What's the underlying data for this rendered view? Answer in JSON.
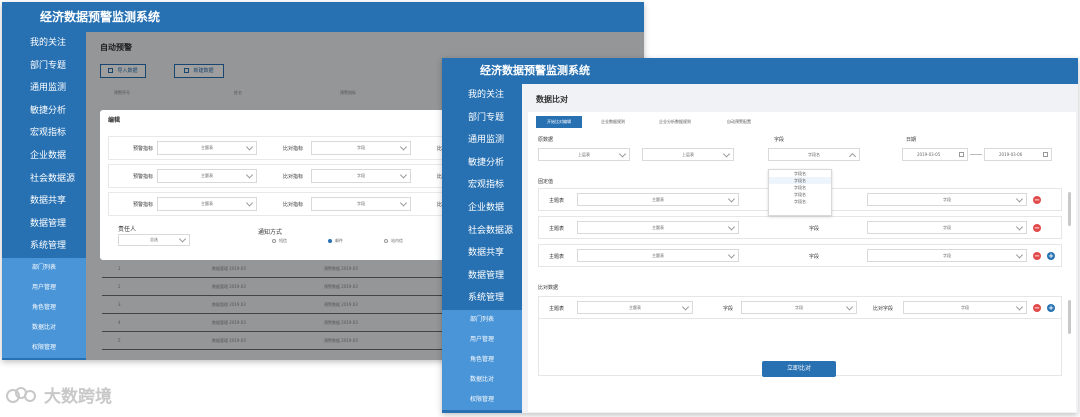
{
  "app_title": "经济数据预警监测系统",
  "nav": {
    "items": [
      "我的关注",
      "部门专题",
      "通用监测",
      "敏捷分析",
      "宏观指标",
      "企业数据",
      "社会数据源",
      "数据共享",
      "数据管理",
      "系统管理"
    ],
    "sub_items": [
      "部门列表",
      "用户管理",
      "角色管理",
      "数据比对",
      "权限管理"
    ]
  },
  "back_window": {
    "page_title": "自动预警",
    "import_label": "导入数据",
    "new_label": "新建数据",
    "table_headers": [
      "预警序号",
      "姓名",
      "预警指标"
    ],
    "rows": [
      {
        "index": "1",
        "text": "数据管理 2019.03",
        "text2": "预警数据 2019.03"
      },
      {
        "index": "2",
        "text": "数据管理 2019.03",
        "text2": "预警数据 2019.03"
      },
      {
        "index": "3",
        "text": "数据管理 2019.03",
        "text2": "预警数据 2019.03"
      },
      {
        "index": "4",
        "text": "数据管理 2019.03",
        "text2": "预警数据 2019.03"
      },
      {
        "index": "5",
        "text": "数据管理 2019.03",
        "text2": "预警数据 2019.03"
      }
    ],
    "dialog": {
      "title": "编辑",
      "row_label_warn": "预警指标",
      "row_label_compare": "比对指标",
      "select_topic": "主题表",
      "select_field": "字段",
      "responsible_label": "责任人",
      "responsible_value": "总选",
      "notify_label": "通知方式",
      "notify_options": [
        "短信",
        "邮件",
        "站内信"
      ]
    }
  },
  "front_window": {
    "page_title": "数据比对",
    "tabs": [
      "开始比对编辑",
      "企业数据规则",
      "企业分析数据规则",
      "自动预警配置"
    ],
    "source_label": "原数据",
    "field_label": "字段",
    "date_label": "日期",
    "source_select_1": "上层表",
    "source_select_2": "上层表",
    "field_select": "字段名",
    "date_start": "2019-03-05",
    "date_end": "2019-03-06",
    "dropdown_options": [
      "字段名",
      "字段名",
      "字段名",
      "字段名",
      "字段名"
    ],
    "fixed_section": "固定值",
    "compare_section": "比对数据",
    "row_topic_label": "主题表",
    "row_field_label": "字段",
    "row_compare_field_label": "比对字段",
    "topic_value": "主题表",
    "field_value": "字段",
    "submit_label": "立即比对"
  },
  "watermark": "大数跨境"
}
